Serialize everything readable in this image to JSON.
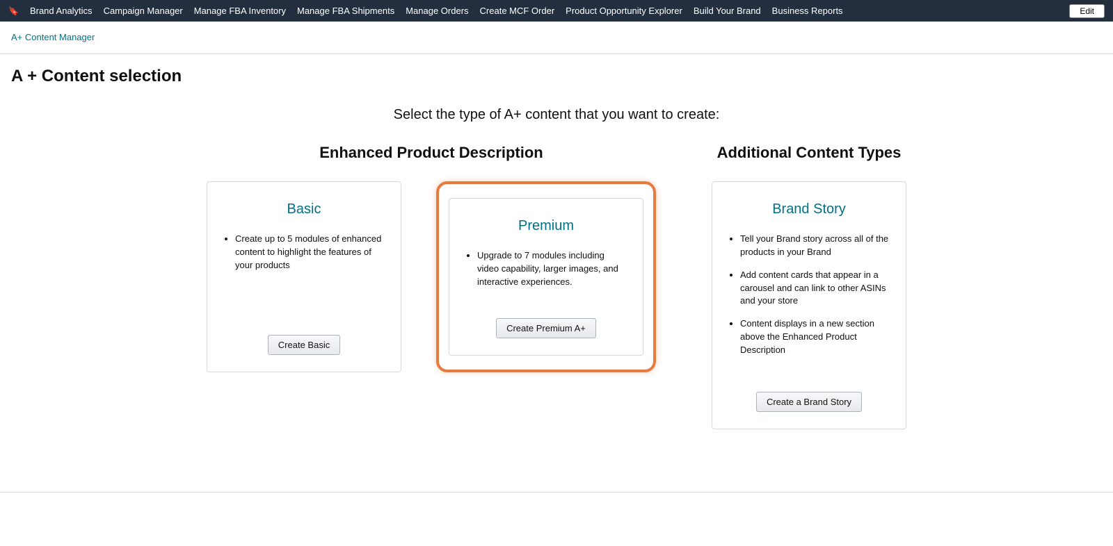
{
  "nav": {
    "items": [
      "Brand Analytics",
      "Campaign Manager",
      "Manage FBA Inventory",
      "Manage FBA Shipments",
      "Manage Orders",
      "Create MCF Order",
      "Product Opportunity Explorer",
      "Build Your Brand",
      "Business Reports"
    ],
    "edit_label": "Edit"
  },
  "breadcrumb": {
    "link": "A+ Content Manager"
  },
  "page_title": "A + Content selection",
  "intro": "Select the type of A+ content that you want to create:",
  "columns": {
    "enhanced": {
      "header": "Enhanced Product Description",
      "basic": {
        "title": "Basic",
        "bullets": [
          "Create up to 5 modules of enhanced content to highlight the features of your products"
        ],
        "button": "Create Basic"
      },
      "premium": {
        "title": "Premium",
        "bullets": [
          "Upgrade to 7 modules including video capability, larger images, and interactive experiences."
        ],
        "button": "Create Premium A+"
      }
    },
    "additional": {
      "header": "Additional Content Types",
      "brandstory": {
        "title": "Brand Story",
        "bullets": [
          "Tell your Brand story across all of the products in your Brand",
          "Add content cards that appear in a carousel and can link to other ASINs and your store",
          "Content displays in a new section above the Enhanced Product Description"
        ],
        "button": "Create a Brand Story"
      }
    }
  }
}
